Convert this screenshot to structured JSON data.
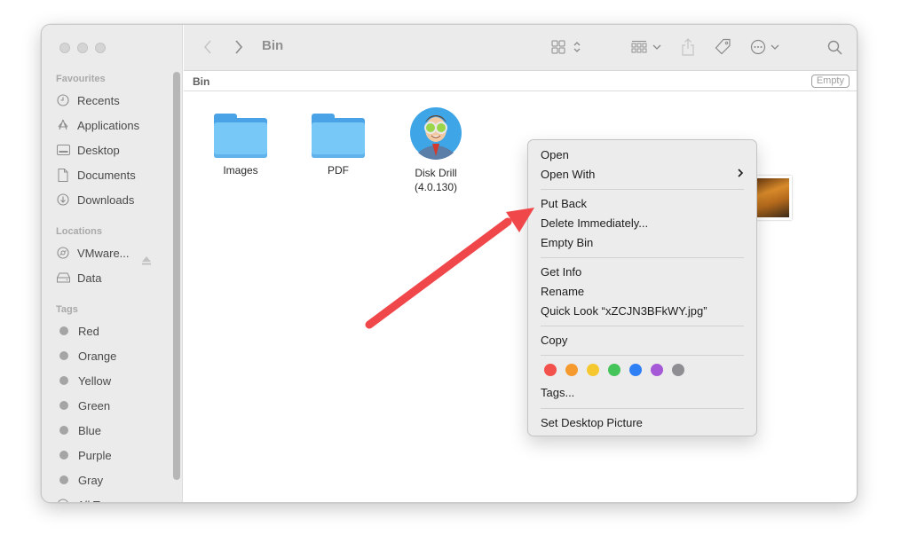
{
  "window": {
    "title": "Bin",
    "path_name": "Bin",
    "empty_button": "Empty"
  },
  "sidebar": {
    "favourites_title": "Favourites",
    "favourites": [
      {
        "label": "Recents",
        "icon": "clock-icon"
      },
      {
        "label": "Applications",
        "icon": "applications-icon"
      },
      {
        "label": "Desktop",
        "icon": "desktop-icon"
      },
      {
        "label": "Documents",
        "icon": "document-icon"
      },
      {
        "label": "Downloads",
        "icon": "download-icon"
      }
    ],
    "locations_title": "Locations",
    "locations": [
      {
        "label": "VMware...",
        "icon": "disc-icon"
      },
      {
        "label": "Data",
        "icon": "drive-icon"
      }
    ],
    "tags_title": "Tags",
    "tags": [
      {
        "label": "Red"
      },
      {
        "label": "Orange"
      },
      {
        "label": "Yellow"
      },
      {
        "label": "Green"
      },
      {
        "label": "Blue"
      },
      {
        "label": "Purple"
      },
      {
        "label": "Gray"
      },
      {
        "label": "All Tags..."
      }
    ]
  },
  "files": [
    {
      "name": "Images",
      "type": "folder"
    },
    {
      "name": "PDF",
      "type": "folder"
    },
    {
      "name": "Disk Drill\n(4.0.130)",
      "name_line1": "Disk Drill",
      "name_line2": "(4.0.130)",
      "type": "app"
    },
    {
      "name": "xZCJN3",
      "type": "image",
      "selected": true
    },
    {
      "name": "",
      "type": "image"
    }
  ],
  "context_menu": {
    "items": [
      {
        "label": "Open"
      },
      {
        "label": "Open With",
        "submenu": true
      },
      {
        "label": "Put Back"
      },
      {
        "label": "Delete Immediately..."
      },
      {
        "label": "Empty Bin"
      },
      {
        "label": "Get Info"
      },
      {
        "label": "Rename"
      },
      {
        "label": "Quick Look “xZCJN3BFkWY.jpg”"
      },
      {
        "label": "Copy"
      },
      {
        "label": "Tags..."
      },
      {
        "label": "Set Desktop Picture"
      }
    ],
    "tag_colors": [
      "#f2514c",
      "#f59a2e",
      "#f6c82f",
      "#45c45a",
      "#2f7ff5",
      "#a659d6",
      "#8e8e93"
    ],
    "submenu_arrow": "›"
  },
  "annotation": {
    "arrow_color": "#f0474b"
  }
}
